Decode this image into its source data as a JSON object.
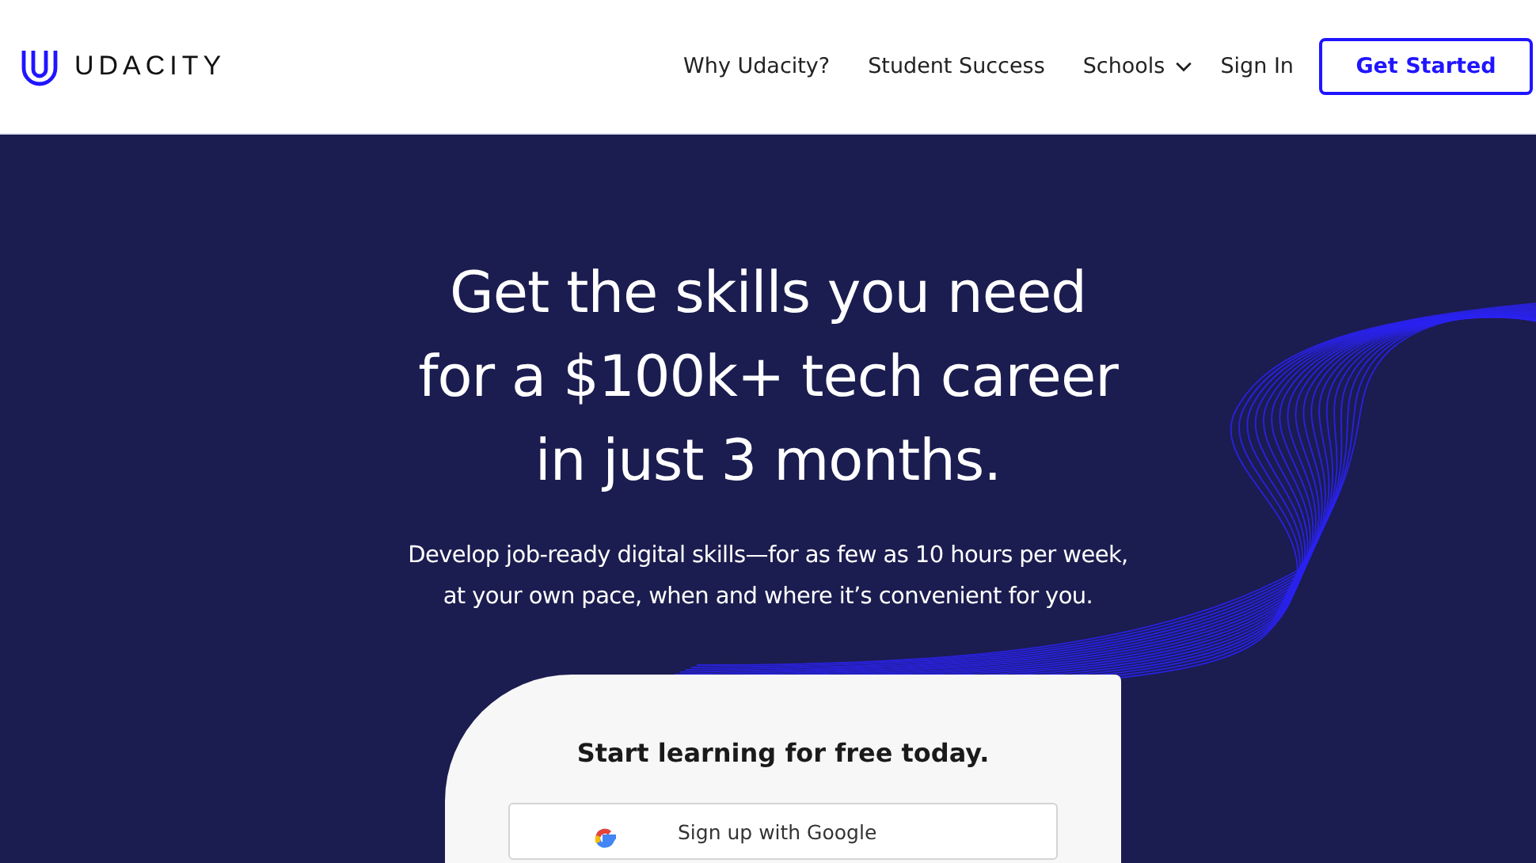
{
  "header": {
    "logo_text": "UDACITY",
    "nav": [
      {
        "label": "Why Udacity?",
        "kind": "link"
      },
      {
        "label": "Student Success",
        "kind": "link"
      },
      {
        "label": "Schools",
        "kind": "dropdown"
      },
      {
        "label": "Sign In",
        "kind": "link"
      }
    ],
    "cta": "Get Started"
  },
  "hero": {
    "headline_lines": [
      "Get the skills you need",
      "for a $100k+ tech career",
      "in just 3 months."
    ],
    "subtitle_lines": [
      "Develop job-ready digital skills—for as few as 10 hours per week,",
      "at your own pace, when and where it’s convenient for you."
    ]
  },
  "signup_card": {
    "title": "Start learning for free today.",
    "google_button": "Sign up with Google"
  }
}
